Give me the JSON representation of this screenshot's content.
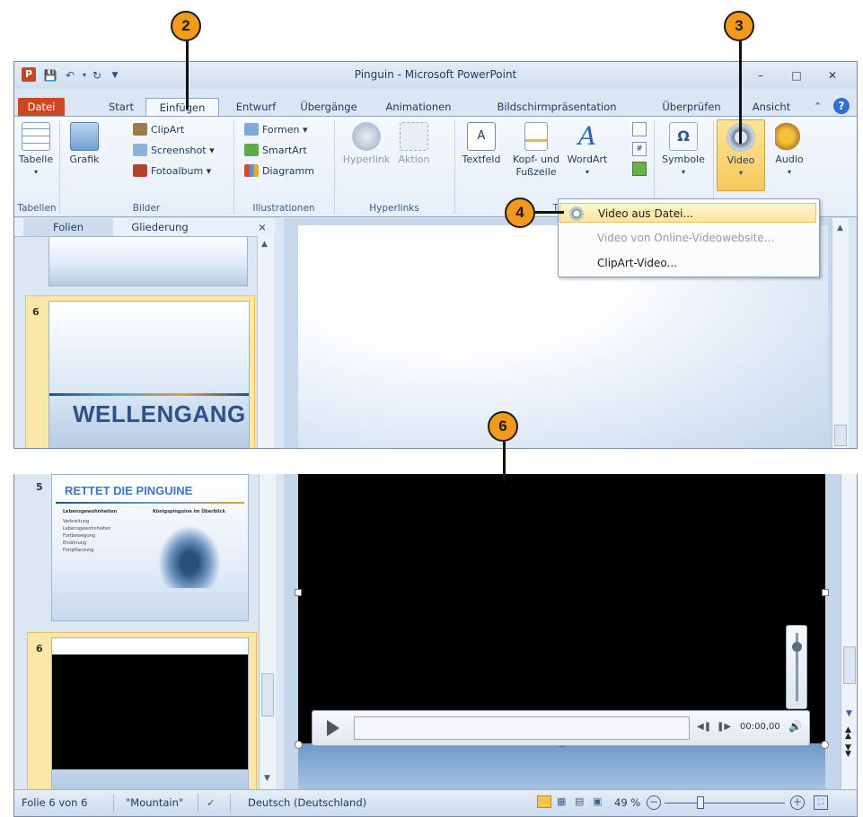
{
  "callouts": {
    "c2": "2",
    "c3": "3",
    "c4": "4",
    "c6": "6"
  },
  "window": {
    "title": "Pinguin - Microsoft PowerPoint",
    "app_icon": "P"
  },
  "tabs": [
    "Datei",
    "Start",
    "Einfügen",
    "Entwurf",
    "Übergänge",
    "Animationen",
    "Bildschirmpräsentation",
    "Überprüfen",
    "Ansicht"
  ],
  "ribbon": {
    "table": "Tabelle",
    "picture": "Grafik",
    "clipart": "ClipArt",
    "screenshot": "Screenshot",
    "photoalbum": "Fotoalbum",
    "shapes": "Formen",
    "smartart": "SmartArt",
    "chart": "Diagramm",
    "hyperlink": "Hyperlink",
    "action": "Aktion",
    "textbox": "Textfeld",
    "header_footer_1": "Kopf- und",
    "header_footer_2": "Fußzeile",
    "wordart": "WordArt",
    "symbols": "Symbole",
    "video": "Video",
    "audio": "Audio",
    "groups": {
      "tables": "Tabellen",
      "images": "Bilder",
      "illustrations": "Illustrationen",
      "links": "Hyperlinks",
      "text_partial": "Te"
    }
  },
  "video_menu": {
    "items": [
      "Video aus Datei...",
      "Video von Online-Videowebsite...",
      "ClipArt-Video..."
    ]
  },
  "pane": {
    "tab_slides": "Folien",
    "tab_outline": "Gliederung",
    "close": "×"
  },
  "slides": {
    "num6": "6",
    "num5": "5",
    "wellengang": "WELLENGANG",
    "rettet": "RETTET DIE PINGUINE",
    "col_left": "Lebensgewohnheiten",
    "col_right": "Königspinguine im Überblick",
    "bullets": [
      "Verbreitung",
      "Lebensgewohnheiten",
      "Fortbewegung",
      "Ernährung",
      "Fortpflanzung"
    ]
  },
  "player": {
    "time": "00:00,00"
  },
  "status": {
    "slide_of": "Folie 6 von 6",
    "theme": "\"Mountain\"",
    "language": "Deutsch (Deutschland)",
    "zoom": "49 %"
  },
  "colors": {
    "file_tab": "#cd4624",
    "callout": "#f39a1b",
    "highlight": "#f8c85c"
  }
}
